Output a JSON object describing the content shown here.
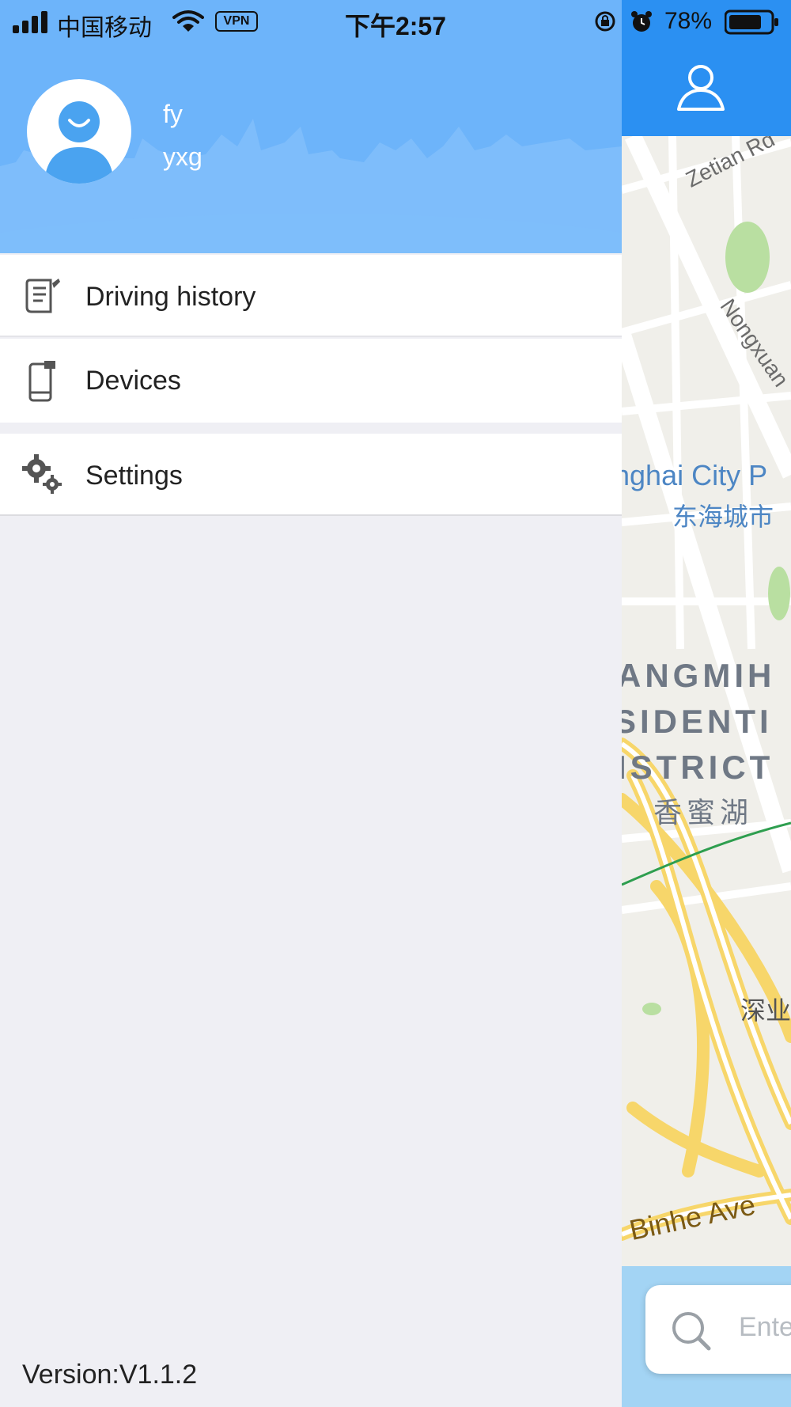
{
  "status_bar": {
    "carrier": "中国移动",
    "vpn": "VPN",
    "time": "下午2:57",
    "battery_percent": "78%",
    "icons": [
      "signal-icon",
      "wifi-icon",
      "vpn-icon",
      "rotation-lock-icon",
      "alarm-icon",
      "battery-icon"
    ]
  },
  "drawer": {
    "user": {
      "name": "fy",
      "account": "yxg"
    },
    "menu": [
      {
        "label": "Driving history",
        "icon": "driving-history-icon"
      },
      {
        "label": "Devices",
        "icon": "device-icon"
      },
      {
        "label": "Settings",
        "icon": "settings-gear-icon"
      }
    ],
    "version": "Version:V1.1.2"
  },
  "map": {
    "labels": {
      "zetian_rd": "Zetian Rd",
      "nongxuan": "Nongxuan",
      "city_park_en": "nghai City P",
      "city_park_cn": "东海城市",
      "district_line1": "ANGMIH",
      "district_line2": "SIDENTI",
      "district_line3": "ISTRICT",
      "district_cn": "香蜜湖",
      "shen": "深业",
      "binhe_ave": "Binhe Ave"
    },
    "search_placeholder": "Ente",
    "colors": {
      "topbar": "#2b90f2",
      "drawer_header": "#6db4fa",
      "road_yellow": "#f7d66a"
    }
  }
}
